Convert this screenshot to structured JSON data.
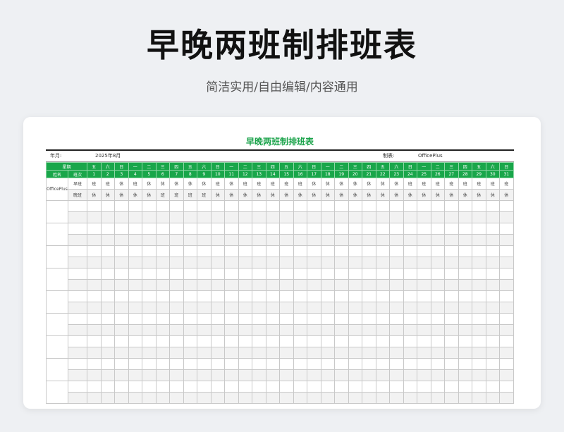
{
  "hero": {
    "title": "早晚两班制排班表",
    "subtitle": "简洁实用/自由编辑/内容通用"
  },
  "sheet": {
    "title": "早晚两班制排班表",
    "month_label": "年月:",
    "month_value": "2025年8月",
    "maker_label": "制表:",
    "maker_value": "OfficePlus",
    "header": {
      "week_label": "星期",
      "name_label": "姓名",
      "shift_label": "班次",
      "weekdays": [
        "五",
        "六",
        "日",
        "一",
        "二",
        "三",
        "四",
        "五",
        "六",
        "日",
        "一",
        "二",
        "三",
        "四",
        "五",
        "六",
        "日",
        "一",
        "二",
        "三",
        "四",
        "五",
        "六",
        "日",
        "一",
        "二",
        "三",
        "四",
        "五",
        "六",
        "日"
      ],
      "days": [
        "1",
        "2",
        "3",
        "4",
        "5",
        "6",
        "7",
        "8",
        "9",
        "10",
        "11",
        "12",
        "13",
        "14",
        "15",
        "16",
        "17",
        "18",
        "19",
        "20",
        "21",
        "22",
        "23",
        "24",
        "25",
        "26",
        "27",
        "28",
        "29",
        "30",
        "31"
      ]
    },
    "employees": [
      {
        "name": "OfficePlus",
        "shifts": [
          {
            "label": "早班",
            "values": [
              "班",
              "班",
              "休",
              "班",
              "休",
              "休",
              "休",
              "休",
              "休",
              "班",
              "休",
              "班",
              "班",
              "班",
              "班",
              "班",
              "休",
              "休",
              "休",
              "休",
              "休",
              "休",
              "休",
              "班",
              "班",
              "班",
              "班",
              "班",
              "班",
              "班",
              "班"
            ]
          },
          {
            "label": "晚班",
            "values": [
              "休",
              "休",
              "休",
              "休",
              "休",
              "班",
              "班",
              "班",
              "班",
              "休",
              "休",
              "休",
              "休",
              "休",
              "休",
              "休",
              "休",
              "休",
              "休",
              "休",
              "休",
              "休",
              "休",
              "休",
              "休",
              "休",
              "休",
              "休",
              "休",
              "休",
              "休"
            ]
          }
        ]
      },
      {
        "name": "",
        "shifts": [
          {
            "label": "",
            "values": []
          },
          {
            "label": "",
            "values": []
          }
        ]
      },
      {
        "name": "",
        "shifts": [
          {
            "label": "",
            "values": []
          },
          {
            "label": "",
            "values": []
          }
        ]
      },
      {
        "name": "",
        "shifts": [
          {
            "label": "",
            "values": []
          },
          {
            "label": "",
            "values": []
          }
        ]
      },
      {
        "name": "",
        "shifts": [
          {
            "label": "",
            "values": []
          },
          {
            "label": "",
            "values": []
          }
        ]
      },
      {
        "name": "",
        "shifts": [
          {
            "label": "",
            "values": []
          },
          {
            "label": "",
            "values": []
          }
        ]
      },
      {
        "name": "",
        "shifts": [
          {
            "label": "",
            "values": []
          },
          {
            "label": "",
            "values": []
          }
        ]
      },
      {
        "name": "",
        "shifts": [
          {
            "label": "",
            "values": []
          },
          {
            "label": "",
            "values": []
          }
        ]
      },
      {
        "name": "",
        "shifts": [
          {
            "label": "",
            "values": []
          },
          {
            "label": "",
            "values": []
          }
        ]
      },
      {
        "name": "",
        "shifts": [
          {
            "label": "",
            "values": []
          },
          {
            "label": "",
            "values": []
          }
        ]
      }
    ]
  }
}
